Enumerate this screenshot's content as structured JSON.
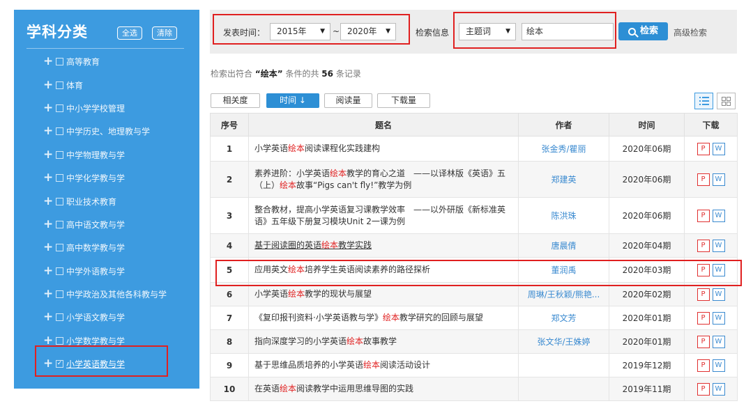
{
  "sidebar": {
    "title": "学科分类",
    "select_all": "全选",
    "clear": "清除",
    "items": [
      {
        "label": "高等教育",
        "checked": false
      },
      {
        "label": "体育",
        "checked": false
      },
      {
        "label": "中小学学校管理",
        "checked": false
      },
      {
        "label": "中学历史、地理教与学",
        "checked": false
      },
      {
        "label": "中学物理教与学",
        "checked": false
      },
      {
        "label": "中学化学教与学",
        "checked": false
      },
      {
        "label": "职业技术教育",
        "checked": false
      },
      {
        "label": "高中语文教与学",
        "checked": false
      },
      {
        "label": "高中数学教与学",
        "checked": false
      },
      {
        "label": "中学外语教与学",
        "checked": false
      },
      {
        "label": "中学政治及其他各科教与学",
        "checked": false
      },
      {
        "label": "小学语文教与学",
        "checked": false
      },
      {
        "label": "小学数学教与学",
        "checked": false
      },
      {
        "label": "小学英语教与学",
        "checked": true
      }
    ],
    "plus_glyph": "+",
    "check_glyph": "✓"
  },
  "search": {
    "time_label": "发表时间：",
    "year_from": "2015年",
    "range_sep": "~",
    "year_to": "2020年",
    "info_label": "检索信息",
    "field": "主题词",
    "keyword": "绘本",
    "search_button": "检索",
    "advanced": "高级检索",
    "caret": "▼"
  },
  "result_info": {
    "prefix": "检索出符合",
    "keyword_quoted": "“绘本”",
    "middle": "条件的共",
    "count": "56",
    "suffix": "条记录"
  },
  "sort_tabs": [
    {
      "label": "相关度",
      "active": false
    },
    {
      "label": "时间 ↓",
      "active": true
    },
    {
      "label": "阅读量",
      "active": false
    },
    {
      "label": "下载量",
      "active": false
    }
  ],
  "table": {
    "headers": [
      "序号",
      "题名",
      "作者",
      "时间",
      "下载"
    ],
    "keyword": "绘本",
    "pdf_label": "P",
    "word_label": "W",
    "rows": [
      {
        "no": "1",
        "title": "小学英语绘本阅读课程化实践建构",
        "author": "张金秀/瞿丽",
        "time": "2020年06期"
      },
      {
        "no": "2",
        "title": "素养进阶：小学英语绘本教学的育心之道　——以译林版《英语》五（上）绘本故事“Pigs can't fly!”教学为例",
        "author": "郑建英",
        "time": "2020年06期"
      },
      {
        "no": "3",
        "title": "整合教材，提高小学英语复习课教学效率　——以外研版《新标准英语》五年级下册复习模块Unit 2一课为例",
        "author": "陈洪珠",
        "time": "2020年06期"
      },
      {
        "no": "4",
        "title": "基于阅读圈的英语绘本教学实践",
        "author": "唐晨倩",
        "time": "2020年04期"
      },
      {
        "no": "5",
        "title": "应用英文绘本培养学生英语阅读素养的路径探析",
        "author": "董润禹",
        "time": "2020年03期"
      },
      {
        "no": "6",
        "title": "小学英语绘本教学的现状与展望",
        "author": "周琳/王秋颖/熊艳...",
        "time": "2020年02期"
      },
      {
        "no": "7",
        "title": "《复印报刊资料·小学英语教与学》绘本教学研究的回顾与展望",
        "author": "郑文芳",
        "time": "2020年01期"
      },
      {
        "no": "8",
        "title": "指向深度学习的小学英语绘本故事教学",
        "author": "张文华/王姝婷",
        "time": "2020年01期"
      },
      {
        "no": "9",
        "title": "基于思维品质培养的小学英语绘本阅读活动设计",
        "author": "",
        "time": "2019年12期"
      },
      {
        "no": "10",
        "title": "在英语绘本阅读教学中运用思维导图的实践",
        "author": "",
        "time": "2019年11期"
      }
    ]
  },
  "colors": {
    "sidebar_bg": "#3d9be0",
    "accent": "#2d8fd5",
    "keyword_red": "#e02020",
    "highlight_box": "#e02020",
    "author_blue": "#3a8ad0"
  }
}
